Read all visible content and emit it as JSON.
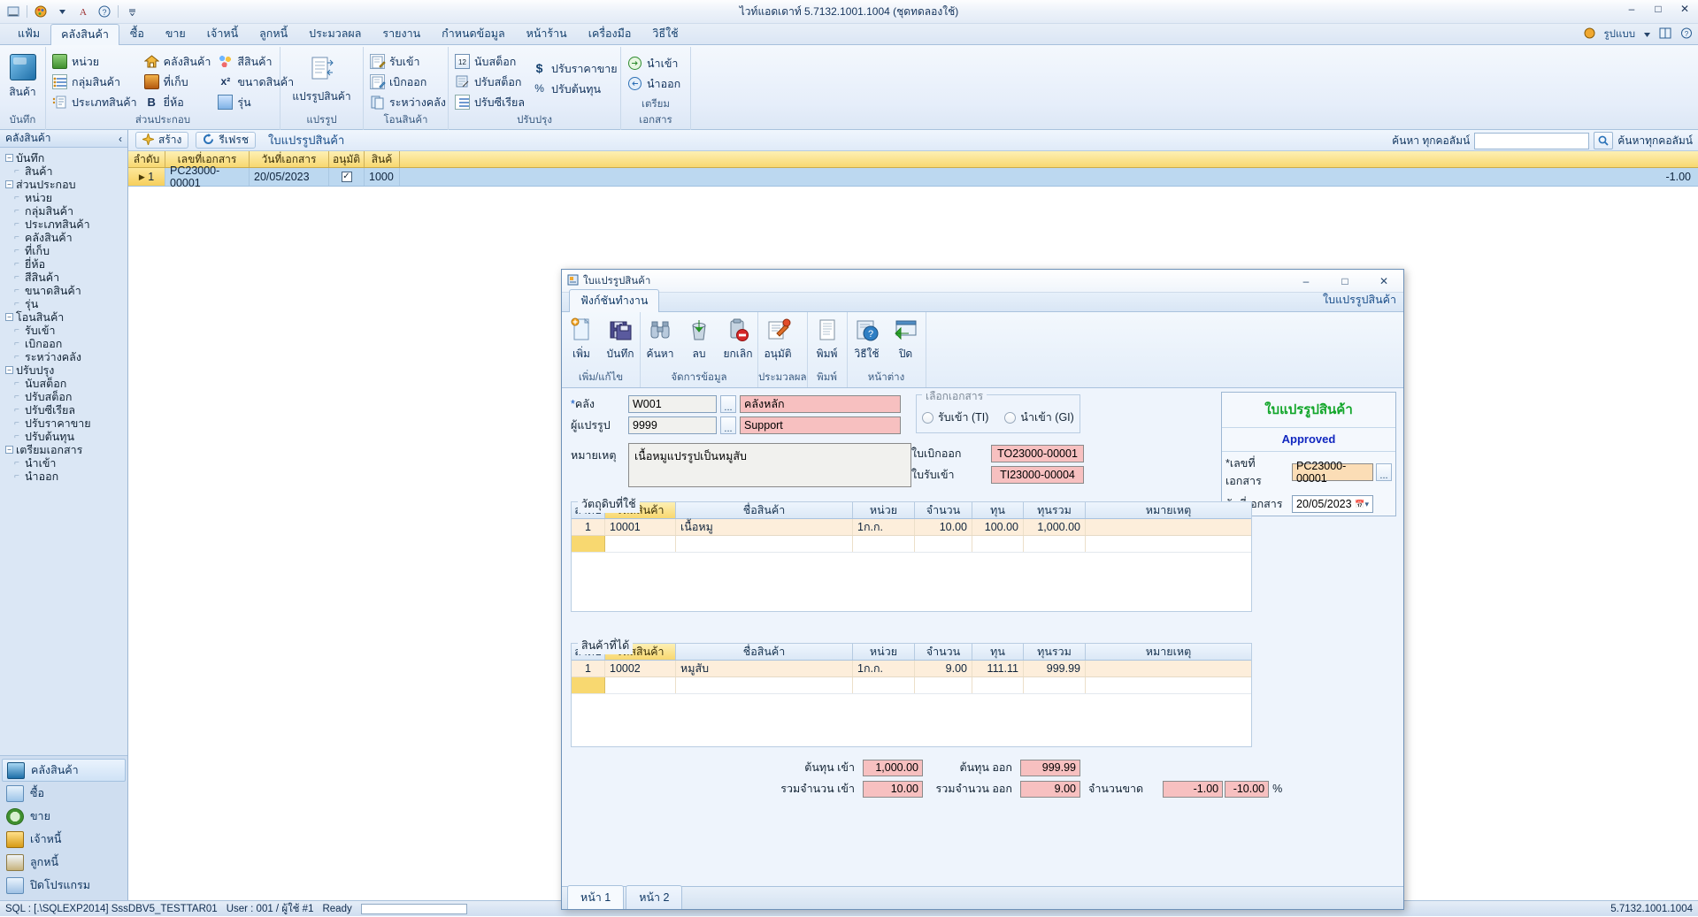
{
  "app": {
    "title": "ไวท์แอดเดาท์ 5.7132.1001.1004 (ชุดทดลองใช้)",
    "qat_icons": [
      "app-icon",
      "palette-icon",
      "font-icon",
      "help-icon",
      "dropdown-icon"
    ],
    "window_buttons": [
      "minimize",
      "maximize",
      "close"
    ]
  },
  "menu": {
    "tabs": [
      "แฟ้ม",
      "คลังสินค้า",
      "ซื้อ",
      "ขาย",
      "เจ้าหนี้",
      "ลูกหนี้",
      "ประมวลผล",
      "รายงาน",
      "กำหนดข้อมูล",
      "หน้าร้าน",
      "เครื่องมือ",
      "วิธีใช้"
    ],
    "active_index": 1,
    "right_label": "รูปแบบ"
  },
  "ribbon": {
    "groups": [
      {
        "name": "บันทึก",
        "big": {
          "label": "สินค้า",
          "icon": "cube-icon"
        },
        "items": []
      },
      {
        "name": "ส่วนประกอบ",
        "big": null,
        "columns": [
          [
            {
              "label": "หน่วย",
              "icon": "unit-icon"
            },
            {
              "label": "กลุ่มสินค้า",
              "icon": "group-icon"
            },
            {
              "label": "ประเภทสินค้า",
              "icon": "type-icon"
            }
          ],
          [
            {
              "label": "คลังสินค้า",
              "icon": "warehouse-icon"
            },
            {
              "label": "ที่เก็บ",
              "icon": "location-icon"
            },
            {
              "label": "ยี่ห้อ",
              "icon": "brand-icon"
            }
          ],
          [
            {
              "label": "สีสินค้า",
              "icon": "color-icon"
            },
            {
              "label": "ขนาดสินค้า",
              "icon": "size-icon"
            },
            {
              "label": "รุ่น",
              "icon": "model-icon"
            }
          ]
        ]
      },
      {
        "name": "แปรรูป",
        "big": {
          "label": "แปรรูปสินค้า",
          "icon": "transform-icon"
        },
        "items": []
      },
      {
        "name": "โอนสินค้า",
        "big": null,
        "columns": [
          [
            {
              "label": "รับเข้า",
              "icon": "receive-icon"
            },
            {
              "label": "เบิกออก",
              "icon": "issue-icon"
            },
            {
              "label": "ระหว่างคลัง",
              "icon": "transfer-icon"
            }
          ]
        ]
      },
      {
        "name": "ปรับปรุง",
        "big": null,
        "columns": [
          [
            {
              "label": "นับสต็อก",
              "icon": "count-icon"
            },
            {
              "label": "ปรับสต็อก",
              "icon": "adjust-icon"
            },
            {
              "label": "ปรับซีเรียล",
              "icon": "serial-icon"
            }
          ],
          [
            {
              "label": "ปรับราคาขาย",
              "icon": "dollar-icon"
            },
            {
              "label": "ปรับต้นทุน",
              "icon": "percent-icon"
            }
          ]
        ]
      },
      {
        "name": "เตรียมเอกสาร",
        "big": null,
        "columns": [
          [
            {
              "label": "นำเข้า",
              "icon": "import-icon"
            },
            {
              "label": "นำออก",
              "icon": "export-icon"
            }
          ]
        ]
      }
    ]
  },
  "sidebar": {
    "header": "คลังสินค้า",
    "collapse_icon": "chevron-left-icon",
    "tree": [
      {
        "label": "บันทึก",
        "level": 0,
        "expanded": true
      },
      {
        "label": "สินค้า",
        "level": 1
      },
      {
        "label": "ส่วนประกอบ",
        "level": 0,
        "expanded": true
      },
      {
        "label": "หน่วย",
        "level": 1
      },
      {
        "label": "กลุ่มสินค้า",
        "level": 1
      },
      {
        "label": "ประเภทสินค้า",
        "level": 1
      },
      {
        "label": "คลังสินค้า",
        "level": 1
      },
      {
        "label": "ที่เก็บ",
        "level": 1
      },
      {
        "label": "ยี่ห้อ",
        "level": 1
      },
      {
        "label": "สีสินค้า",
        "level": 1
      },
      {
        "label": "ขนาดสินค้า",
        "level": 1
      },
      {
        "label": "รุ่น",
        "level": 1
      },
      {
        "label": "โอนสินค้า",
        "level": 0,
        "expanded": true
      },
      {
        "label": "รับเข้า",
        "level": 1
      },
      {
        "label": "เบิกออก",
        "level": 1
      },
      {
        "label": "ระหว่างคลัง",
        "level": 1
      },
      {
        "label": "ปรับปรุง",
        "level": 0,
        "expanded": true
      },
      {
        "label": "นับสต็อก",
        "level": 1
      },
      {
        "label": "ปรับสต็อก",
        "level": 1
      },
      {
        "label": "ปรับซีเรียล",
        "level": 1
      },
      {
        "label": "ปรับราคาขาย",
        "level": 1
      },
      {
        "label": "ปรับต้นทุน",
        "level": 1
      },
      {
        "label": "เตรียมเอกสาร",
        "level": 0,
        "expanded": true
      },
      {
        "label": "นำเข้า",
        "level": 1
      },
      {
        "label": "นำออก",
        "level": 1
      }
    ],
    "nav": [
      {
        "label": "คลังสินค้า",
        "icon": "warehouse-icon",
        "selected": true
      },
      {
        "label": "ซื้อ",
        "icon": "purchase-icon",
        "selected": false
      },
      {
        "label": "ขาย",
        "icon": "sales-icon",
        "selected": false
      },
      {
        "label": "เจ้าหนี้",
        "icon": "payable-icon",
        "selected": false
      },
      {
        "label": "ลูกหนี้",
        "icon": "receivable-icon",
        "selected": false
      },
      {
        "label": "ปิดโปรแกรม",
        "icon": "exit-icon",
        "selected": false
      }
    ]
  },
  "content": {
    "toolbar": {
      "create": "สร้าง",
      "refresh": "รีเฟรช",
      "title": "ใบแปรรูปสินค้า",
      "search_label": "ค้นหา ทุกคอลัมน์",
      "search_value": "",
      "search_icon": "search-icon",
      "find_all_label": "ค้นหาทุกคอลัมน์"
    },
    "grid": {
      "columns": [
        "ลำดับ",
        "เลขที่เอกสาร",
        "วันที่เอกสาร",
        "อนุมัติ",
        "สินค้"
      ],
      "rows": [
        {
          "seq": "1",
          "doc_no": "PC23000-00001",
          "doc_date": "20/05/2023",
          "approved": true,
          "item": "1000",
          "right_value": "-1.00"
        }
      ]
    }
  },
  "modal": {
    "title": "ใบแปรรูปสินค้า",
    "title_icon": "form-icon",
    "window_buttons": [
      "minimize",
      "maximize",
      "close"
    ],
    "tab": "ฟังก์ชันทำงาน",
    "header_right": "ใบแปรรูปสินค้า",
    "ribbon_groups": [
      {
        "name": "เพิ่ม/แก้ไข",
        "buttons": [
          {
            "label": "เพิ่ม",
            "icon": "new-document-icon"
          },
          {
            "label": "บันทึก",
            "icon": "save-icon"
          }
        ]
      },
      {
        "name": "จัดการข้อมูล",
        "buttons": [
          {
            "label": "ค้นหา",
            "icon": "binoculars-icon"
          },
          {
            "label": "ลบ",
            "icon": "delete-icon"
          },
          {
            "label": "ยกเลิก",
            "icon": "cancel-icon"
          }
        ]
      },
      {
        "name": "ประมวลผล",
        "buttons": [
          {
            "label": "อนุมัติ",
            "icon": "approve-icon"
          }
        ]
      },
      {
        "name": "พิมพ์",
        "buttons": [
          {
            "label": "พิมพ์",
            "icon": "print-icon"
          }
        ]
      },
      {
        "name": "หน้าต่าง",
        "buttons": [
          {
            "label": "วิธีใช้",
            "icon": "help-icon"
          },
          {
            "label": "ปิด",
            "icon": "close-window-icon"
          }
        ]
      }
    ],
    "form": {
      "warehouse_label": "คลัง",
      "warehouse_required": "*",
      "warehouse_code": "W001",
      "warehouse_name": "คลังหลัก",
      "user_label": "ผู้แปรรูป",
      "user_code": "9999",
      "user_name": "Support",
      "remark_label": "หมายเหตุ",
      "remark_value": "เนื้อหมูแปรรูปเป็นหมูสับ",
      "doc_select_legend": "เลือกเอกสาร",
      "radio_ti": "รับเข้า (TI)",
      "radio_gi": "นำเข้า (GI)",
      "issue_doc_label": "ใบเบิกออก",
      "issue_doc_value": "TO23000-00001",
      "receive_doc_label": "ใบรับเข้า",
      "receive_doc_value": "TI23000-00004"
    },
    "right_panel": {
      "title": "ใบแปรรูปสินค้า",
      "status": "Approved",
      "doc_no_label": "*เลขที่เอกสาร",
      "doc_no_value": "PC23000-00001",
      "doc_date_label": "วันที่เอกสาร",
      "doc_date_value": "20/05/2023",
      "ellipsis": "...",
      "calendar_icon": "calendar-icon"
    },
    "materials": {
      "legend": "วัตถุดิบที่ใช้",
      "columns": [
        "ลำดับ",
        "รหัสสินค้า",
        "ชื่อสินค้า",
        "หน่วย",
        "จำนวน",
        "ทุน",
        "ทุนรวม",
        "หมายเหตุ"
      ],
      "rows": [
        {
          "seq": "1",
          "code": "10001",
          "name": "เนื้อหมู",
          "unit": "1ก.ก.",
          "qty": "10.00",
          "cost": "100.00",
          "total": "1,000.00",
          "remark": ""
        }
      ]
    },
    "products": {
      "legend": "สินค้าที่ได้",
      "columns": [
        "ลำดับ",
        "รหัสสินค้า",
        "ชื่อสินค้า",
        "หน่วย",
        "จำนวน",
        "ทุน",
        "ทุนรวม",
        "หมายเหตุ"
      ],
      "rows": [
        {
          "seq": "1",
          "code": "10002",
          "name": "หมูสับ",
          "unit": "1ก.ก.",
          "qty": "9.00",
          "cost": "111.11",
          "total": "999.99",
          "remark": ""
        }
      ]
    },
    "summary": {
      "cost_in_label": "ต้นทุน เข้า",
      "cost_in_value": "1,000.00",
      "cost_out_label": "ต้นทุน ออก",
      "cost_out_value": "999.99",
      "qty_in_label": "รวมจำนวน เข้า",
      "qty_in_value": "10.00",
      "qty_out_label": "รวมจำนวน ออก",
      "qty_out_value": "9.00",
      "shortage_label": "จำนวนขาด",
      "shortage_value": "-1.00",
      "shortage_pct_value": "-10.00",
      "pct_sign": "%"
    },
    "page_tabs": [
      {
        "label": "หน้า 1",
        "active": true
      },
      {
        "label": "หน้า 2",
        "active": false
      }
    ]
  },
  "statusbar": {
    "sql": "SQL : [.\\SQLEXP2014] SssDBV5_TESTTAR01",
    "user": "User : 001 / ผู้ใช้ #1",
    "ready": "Ready",
    "version": "5.7132.1001.1004"
  }
}
